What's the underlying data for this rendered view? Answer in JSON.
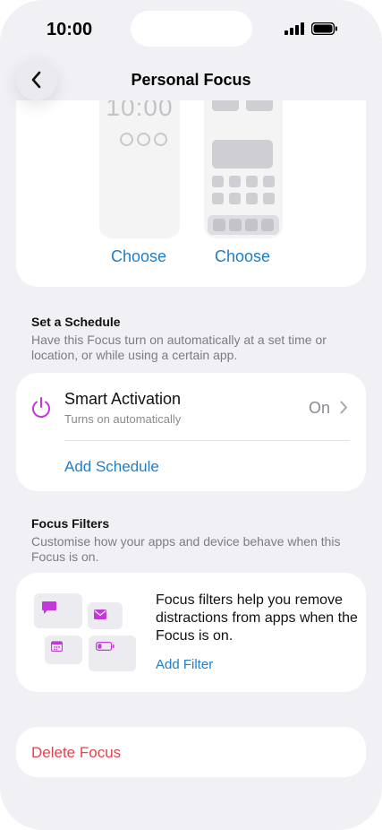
{
  "status": {
    "time": "10:00"
  },
  "nav": {
    "title": "Personal Focus",
    "back_icon": "chevron-left-icon"
  },
  "wallpapers": {
    "lock_clock": "10:00",
    "choose_lock_label": "Choose",
    "choose_home_label": "Choose"
  },
  "schedule": {
    "section_title": "Set a Schedule",
    "section_desc": "Have this Focus turn on automatically at a set time or location, or while using a certain app.",
    "smart_title": "Smart Activation",
    "smart_sub": "Turns on automatically",
    "smart_value": "On",
    "add_label": "Add Schedule"
  },
  "filters": {
    "section_title": "Focus Filters",
    "section_desc": "Customise how your apps and device behave when this Focus is on.",
    "description": "Focus filters help you remove distractions from apps when the Focus is on.",
    "add_label": "Add Filter"
  },
  "delete": {
    "label": "Delete Focus"
  },
  "colors": {
    "accent": "#1e7ec8",
    "purple": "#c238d8",
    "danger": "#e0444d",
    "background": "#f1f0f5"
  }
}
